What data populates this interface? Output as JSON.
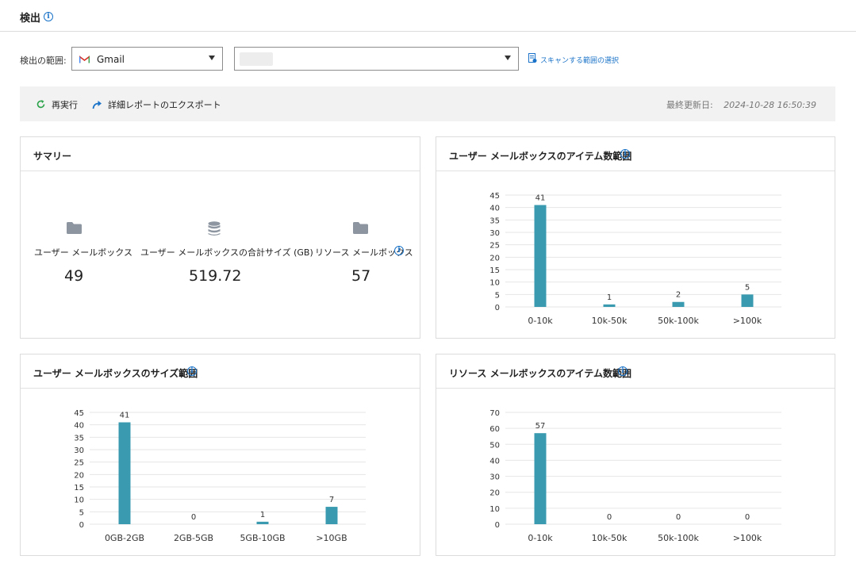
{
  "header": {
    "title": "検出",
    "info_icon": "info-icon"
  },
  "scope": {
    "label": "検出の範囲:",
    "source_select": {
      "value": "Gmail",
      "icon": "gmail-icon"
    },
    "account_select": {
      "value": ""
    },
    "select_scope_link": "スキャンする範囲の選択"
  },
  "toolbar": {
    "rerun_label": "再実行",
    "export_label": "詳細レポートのエクスポート",
    "last_updated_label": "最終更新日:",
    "last_updated_value": "2024-10-28 16:50:39"
  },
  "summary": {
    "title": "サマリー",
    "metrics": [
      {
        "label": "ユーザー メールボックス",
        "value": "49",
        "icon": "folder-icon"
      },
      {
        "label": "ユーザー メールボックスの合計サイズ (GB)",
        "value": "519.72",
        "icon": "database-icon"
      },
      {
        "label": "リソース メールボックス",
        "value": "57",
        "icon": "folder-icon"
      }
    ]
  },
  "panels": {
    "user_items_title": "ユーザー メールボックスのアイテム数範囲",
    "user_size_title": "ユーザー メールボックスのサイズ範囲",
    "res_items_title": "リソース メールボックスのアイテム数範囲"
  },
  "colors": {
    "bar": "#3a9bb0",
    "accent": "#1a73c8",
    "grid": "#e6e6e6"
  },
  "chart_data": [
    {
      "id": "user_items",
      "type": "bar",
      "title": "ユーザー メールボックスのアイテム数範囲",
      "categories": [
        "0-10k",
        "10k-50k",
        "50k-100k",
        ">100k"
      ],
      "values": [
        41,
        1,
        2,
        5
      ],
      "yticks": [
        0,
        5,
        10,
        15,
        20,
        25,
        30,
        35,
        40,
        45
      ],
      "ylim": [
        0,
        45
      ],
      "grid": true
    },
    {
      "id": "user_size",
      "type": "bar",
      "title": "ユーザー メールボックスのサイズ範囲",
      "categories": [
        "0GB-2GB",
        "2GB-5GB",
        "5GB-10GB",
        ">10GB"
      ],
      "values": [
        41,
        0,
        1,
        7
      ],
      "yticks": [
        0,
        5,
        10,
        15,
        20,
        25,
        30,
        35,
        40,
        45
      ],
      "ylim": [
        0,
        45
      ],
      "grid": true
    },
    {
      "id": "res_items",
      "type": "bar",
      "title": "リソース メールボックスのアイテム数範囲",
      "categories": [
        "0-10k",
        "10k-50k",
        "50k-100k",
        ">100k"
      ],
      "values": [
        57,
        0,
        0,
        0
      ],
      "yticks": [
        0,
        10,
        20,
        30,
        40,
        50,
        60,
        70
      ],
      "ylim": [
        0,
        70
      ],
      "grid": true
    }
  ]
}
